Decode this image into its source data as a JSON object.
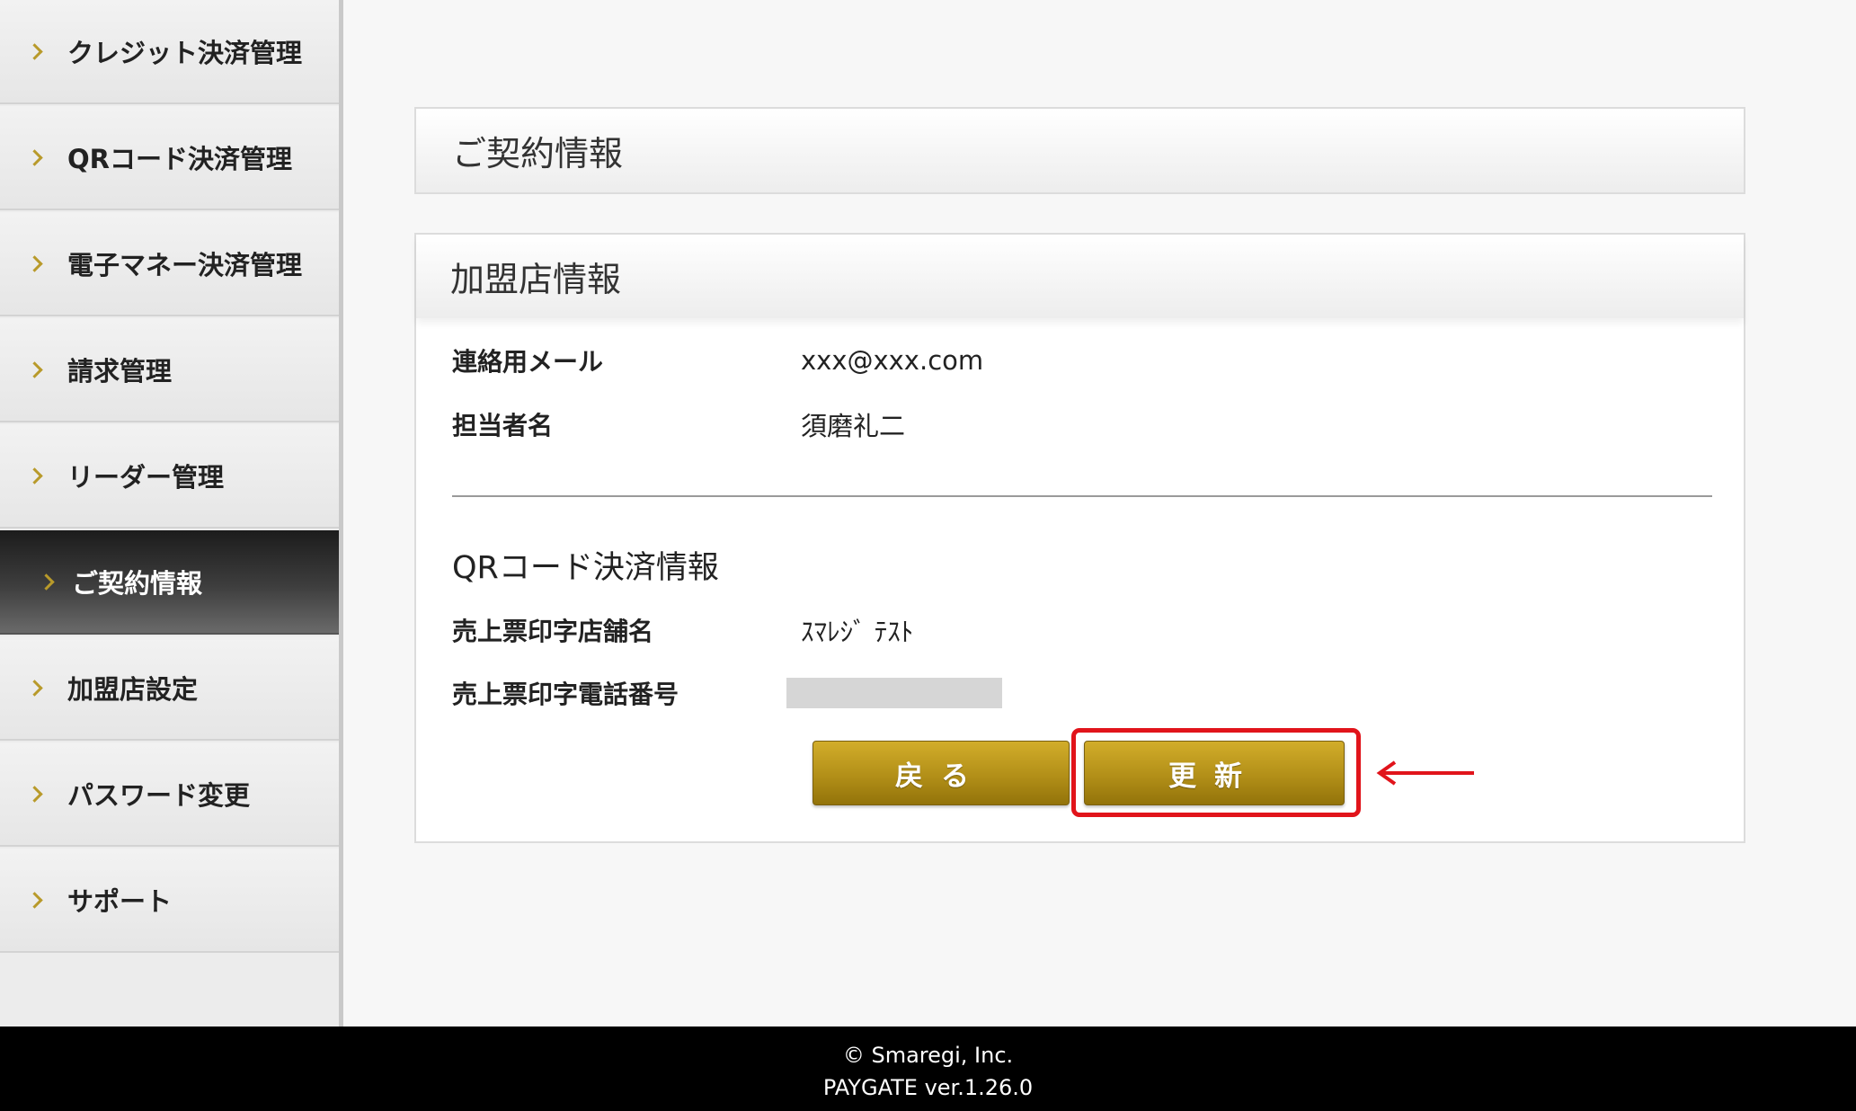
{
  "sidebar": {
    "items": [
      {
        "label": "クレジット決済管理"
      },
      {
        "label": "QRコード決済管理"
      },
      {
        "label": "電子マネー決済管理"
      },
      {
        "label": "請求管理"
      },
      {
        "label": "リーダー管理"
      },
      {
        "label": "ご契約情報"
      },
      {
        "label": "加盟店設定"
      },
      {
        "label": "パスワード変更"
      },
      {
        "label": "サポート"
      }
    ],
    "active_index": 5
  },
  "contract_panel": {
    "title": "ご契約情報"
  },
  "merchant_panel": {
    "title": "加盟店情報",
    "fields": [
      {
        "label": "連絡用メール",
        "value": "xxx@xxx.com"
      },
      {
        "label": "担当者名",
        "value": "須磨礼二"
      }
    ],
    "qr_section": {
      "title": "QRコード決済情報",
      "fields": [
        {
          "label": "売上票印字店舗名",
          "value": "ｽﾏﾚｼﾞ ﾃｽﾄ"
        },
        {
          "label": "売上票印字電話番号",
          "value": ""
        }
      ]
    },
    "buttons": {
      "back_label": "戻る",
      "update_label": "更新"
    }
  },
  "annotation": {
    "highlight_color": "#e1141b"
  },
  "footer": {
    "copyright": "© Smaregi, Inc.",
    "version": "PAYGATE ver.1.26.0"
  }
}
